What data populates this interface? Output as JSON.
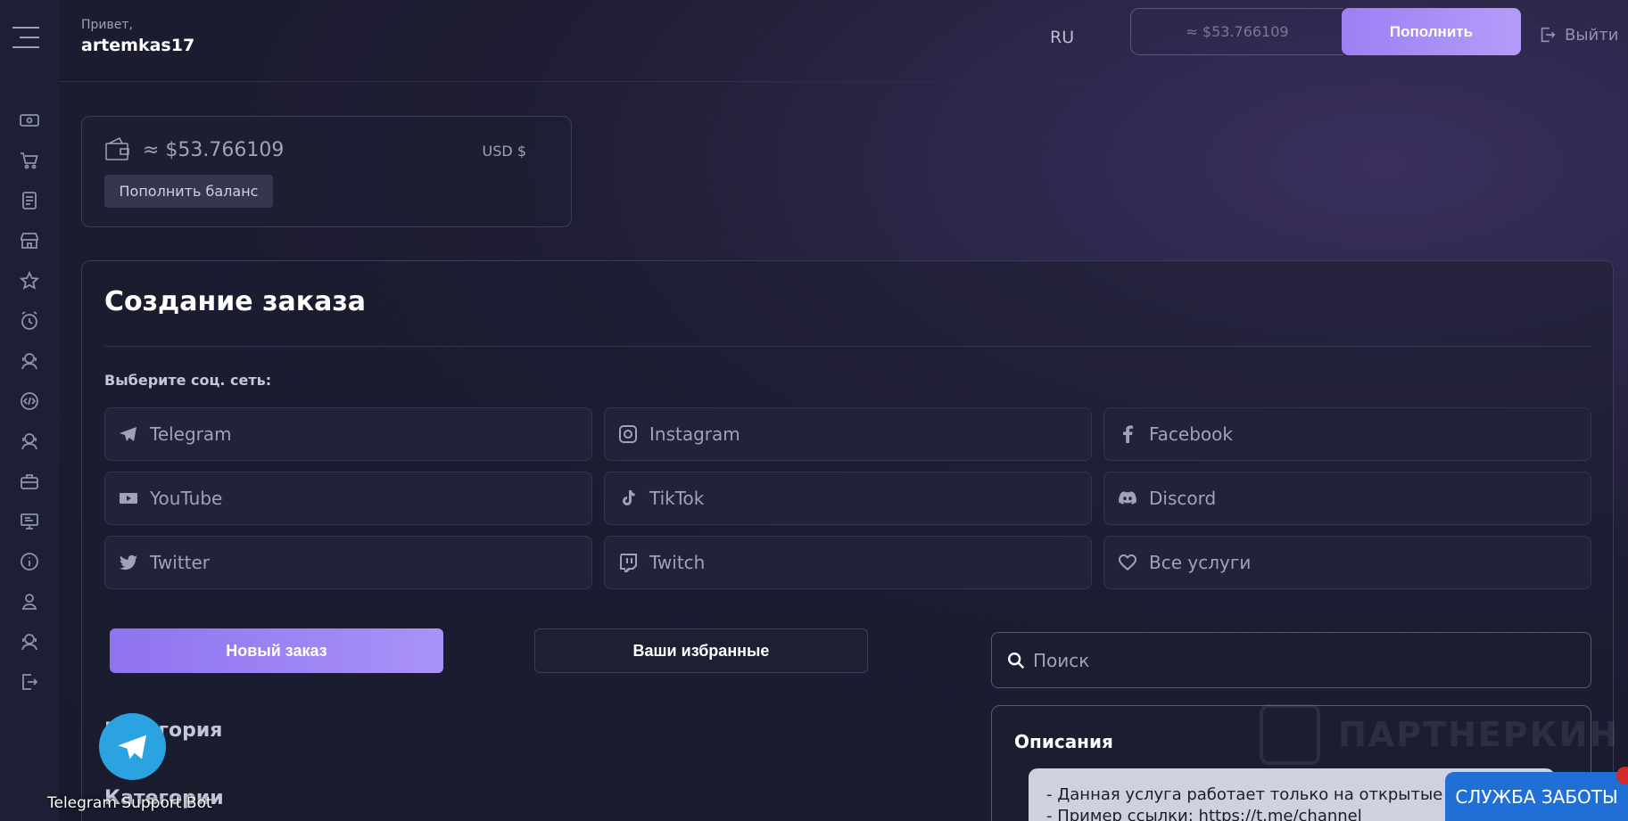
{
  "header": {
    "greeting": "Привет,",
    "username": "artemkas17",
    "language": "RU",
    "balance_display": "≈ $53.766109",
    "topup_label": "Пополнить",
    "logout_label": "Выйти"
  },
  "sidebar": {
    "icons": [
      "money-icon",
      "cart-icon",
      "document-icon",
      "store-icon",
      "star-icon",
      "clock-icon",
      "support-icon",
      "code-icon",
      "support-icon",
      "briefcase-icon",
      "monitor-icon",
      "info-icon",
      "user-icon",
      "support-icon",
      "logout-icon"
    ]
  },
  "balance": {
    "amount": "≈ $53.766109",
    "currency": "USD $",
    "topup_button": "Пополнить баланс"
  },
  "order": {
    "title": "Создание заказа",
    "social_label": "Выберите соц. сеть:",
    "socials": [
      {
        "label": "Telegram",
        "icon": "telegram-icon"
      },
      {
        "label": "Instagram",
        "icon": "instagram-icon"
      },
      {
        "label": "Facebook",
        "icon": "facebook-icon"
      },
      {
        "label": "YouTube",
        "icon": "youtube-icon"
      },
      {
        "label": "TikTok",
        "icon": "tiktok-icon"
      },
      {
        "label": "Discord",
        "icon": "discord-icon"
      },
      {
        "label": "Twitter",
        "icon": "twitter-icon"
      },
      {
        "label": "Twitch",
        "icon": "twitch-icon"
      },
      {
        "label": "Все услуги",
        "icon": "heart-icon"
      }
    ],
    "tab_new": "Новый заказ",
    "tab_favorites": "Ваши избранные",
    "search_placeholder": "Поиск",
    "category_label": "Категория",
    "category_label_2": "Категории",
    "description_title": "Описания",
    "description_line1": "- Данная услуга работает только на открытые ка",
    "description_line2": "- Пример ссылки: https://t.me/channel"
  },
  "watermark": "ПАРТНЕРКИН",
  "telegram_bot_label": "Telegram Support Bot",
  "care_button": "СЛУЖБА ЗАБОТЫ"
}
